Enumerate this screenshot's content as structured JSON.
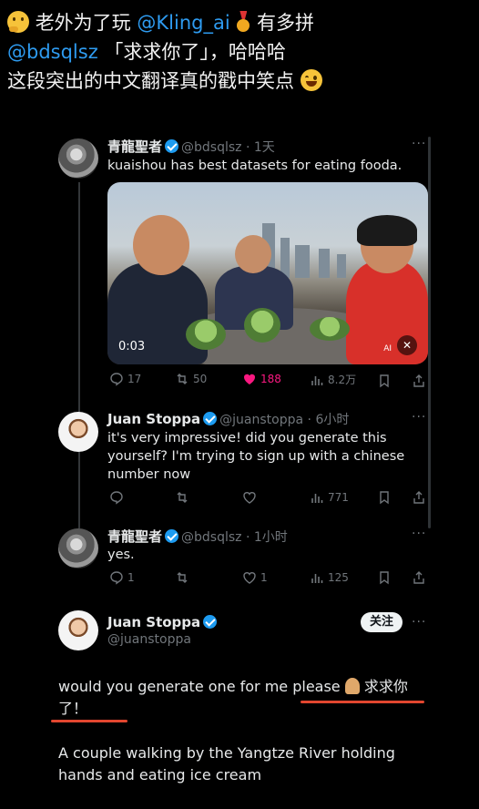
{
  "caption": {
    "line1_pre": "老外为了玩",
    "line1_mention": "@Kling_ai",
    "line1_post": "有多拼",
    "line2_mention": "@bdsqlsz",
    "line2_post": "「求求你了」，哈哈哈",
    "line3": "这段突出的中文翻译真的戳中笑点"
  },
  "tweet1": {
    "name": "青龍聖者",
    "handle": "@bdsqlsz · 1天",
    "text": "kuaishou has best datasets for eating fooda.",
    "video_time": "0:03",
    "video_watermark": "AI",
    "replies": "17",
    "retweets": "50",
    "likes": "188",
    "views": "8.2万"
  },
  "tweet2": {
    "name": "Juan Stoppa",
    "handle": "@juanstoppa · 6小时",
    "text": "it's very impressive! did you generate this yourself? I'm trying to sign up with a chinese number now",
    "views": "771"
  },
  "tweet3": {
    "name": "青龍聖者",
    "handle": "@bdsqlsz · 1小时",
    "text": "yes.",
    "replies": "1",
    "likes": "1",
    "views": "125"
  },
  "main": {
    "name": "Juan Stoppa",
    "handle": "@juanstoppa",
    "follow_label": "关注",
    "text1": "would you generate one for me please",
    "text1_cn": "求求你",
    "text1_cn2": "了！",
    "text2": "A couple walking by the Yangtze River holding hands and eating ice cream"
  },
  "colors": {
    "accent": "#1d9bf0",
    "like": "#f91880",
    "highlight": "#e2462f"
  }
}
